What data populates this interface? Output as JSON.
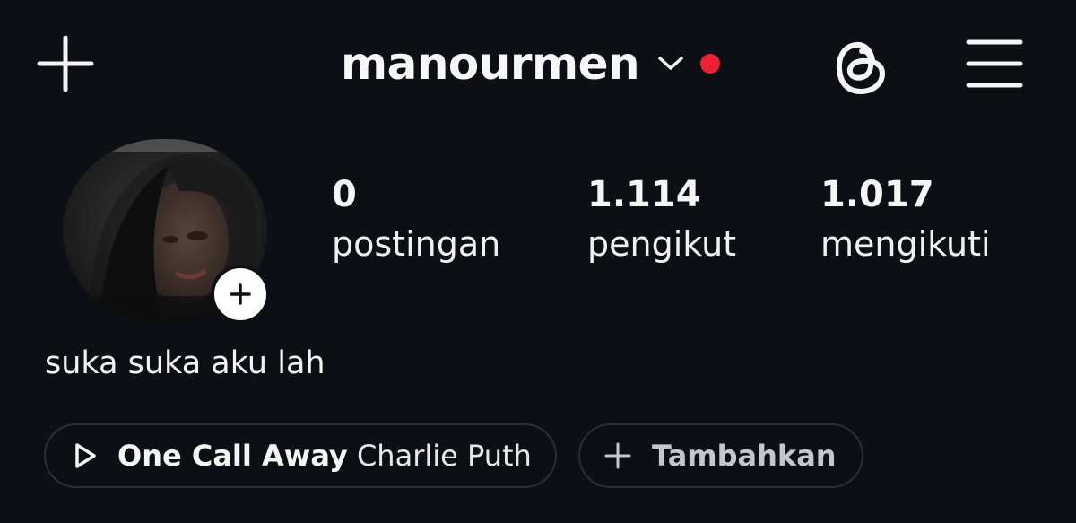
{
  "header": {
    "username": "manourmen",
    "icons": {
      "add": "plus-icon",
      "switcher": "chevron-down-icon",
      "threads": "threads-icon",
      "menu": "hamburger-menu-icon"
    },
    "notification_color": "#ed2035"
  },
  "profile": {
    "avatar_add_icon": "plus-icon",
    "stats": {
      "posts": {
        "value": "0",
        "label": "postingan"
      },
      "followers": {
        "value": "1.114",
        "label": "pengikut"
      },
      "following": {
        "value": "1.017",
        "label": "mengikuti"
      }
    },
    "bio": "suka suka aku lah"
  },
  "music": {
    "icon": "play-icon",
    "title": "One Call Away",
    "artist": "Charlie Puth"
  },
  "add_button": {
    "icon": "plus-icon",
    "label": "Tambahkan"
  },
  "colors": {
    "background": "#0c0f14",
    "text": "#f5f5f5",
    "pill_border": "#2a2e36",
    "notification": "#ed2035"
  }
}
